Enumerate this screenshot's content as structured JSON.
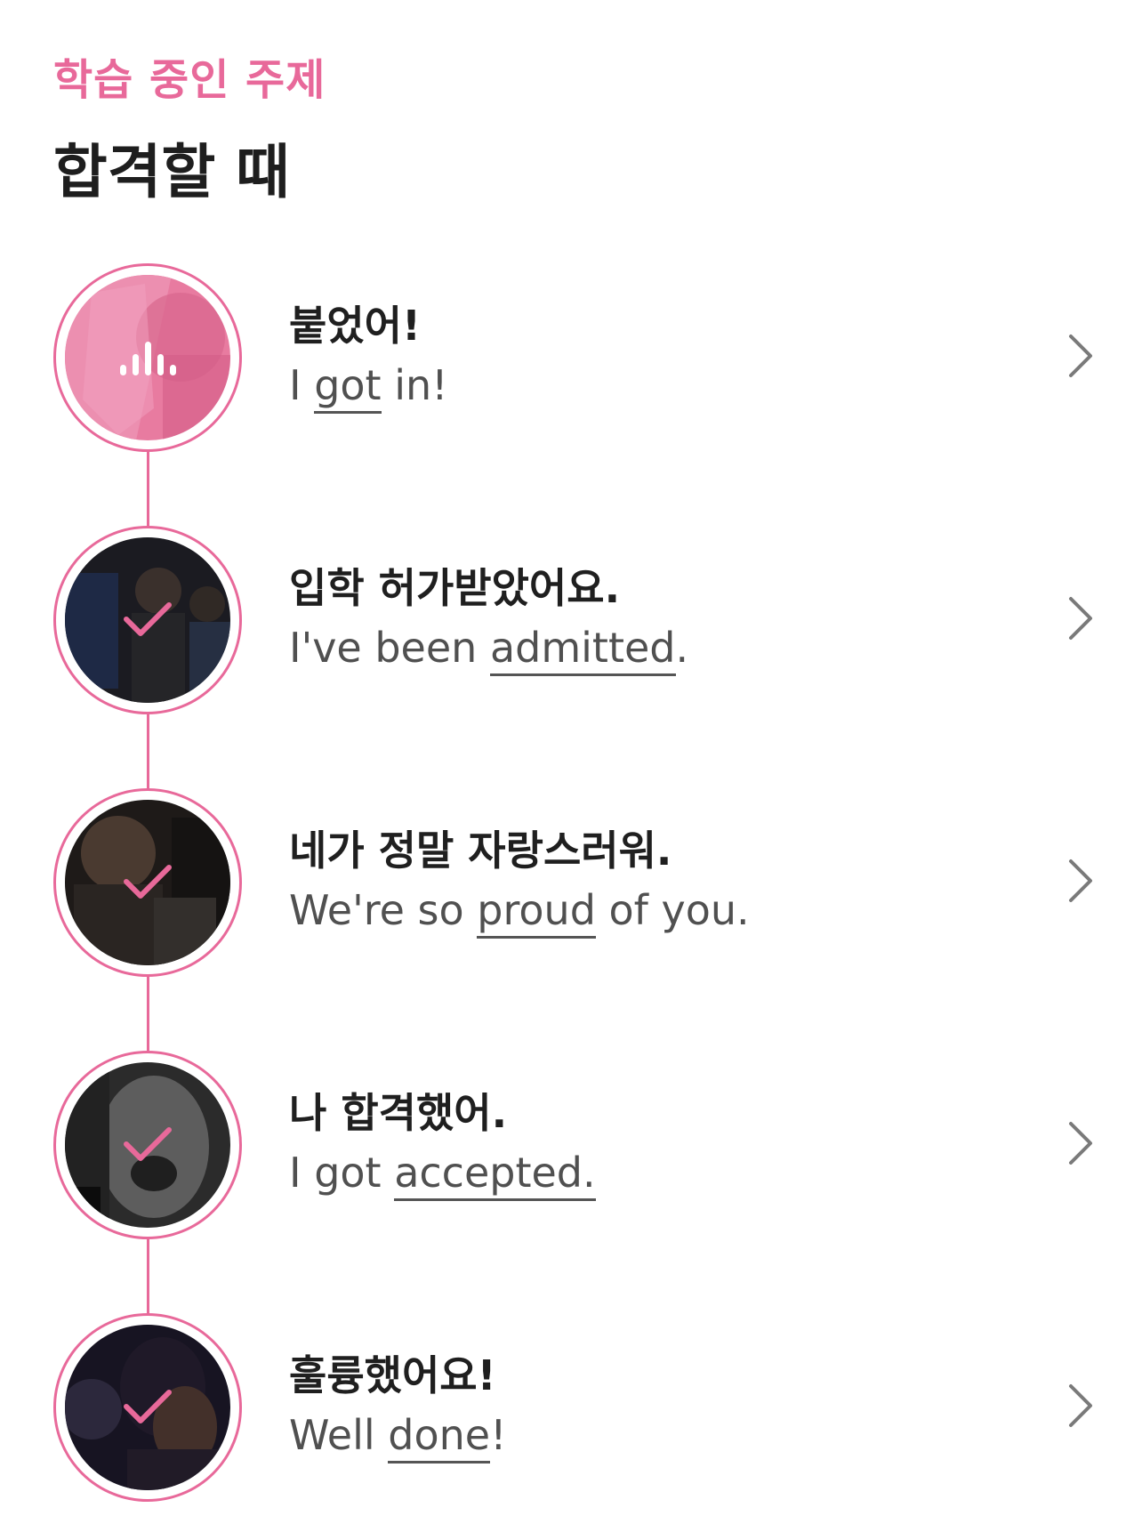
{
  "header": {
    "eyebrow": "학습 중인 주제",
    "title": "합격할 때"
  },
  "colors": {
    "accent": "#e8699a",
    "title_text": "#1e1e1e",
    "subtitle_text": "#505050",
    "chevron": "#7a7a7a"
  },
  "lessons": [
    {
      "korean": "붙었어!",
      "english_before": "I ",
      "english_keyword": "got",
      "english_after": " in!",
      "state": "playing",
      "icon": "audio-wave-icon"
    },
    {
      "korean": "입학 허가받았어요.",
      "english_before": "I've been ",
      "english_keyword": "admitted",
      "english_after": ".",
      "state": "completed",
      "icon": "check-icon"
    },
    {
      "korean": "네가 정말 자랑스러워.",
      "english_before": "We're so ",
      "english_keyword": "proud",
      "english_after": " of you.",
      "state": "completed",
      "icon": "check-icon"
    },
    {
      "korean": "나 합격했어.",
      "english_before": "I got ",
      "english_keyword": "accepted.",
      "english_after": "",
      "state": "completed",
      "icon": "check-icon"
    },
    {
      "korean": "훌륭했어요!",
      "english_before": "Well ",
      "english_keyword": "done",
      "english_after": "!",
      "state": "completed",
      "icon": "check-icon"
    }
  ]
}
